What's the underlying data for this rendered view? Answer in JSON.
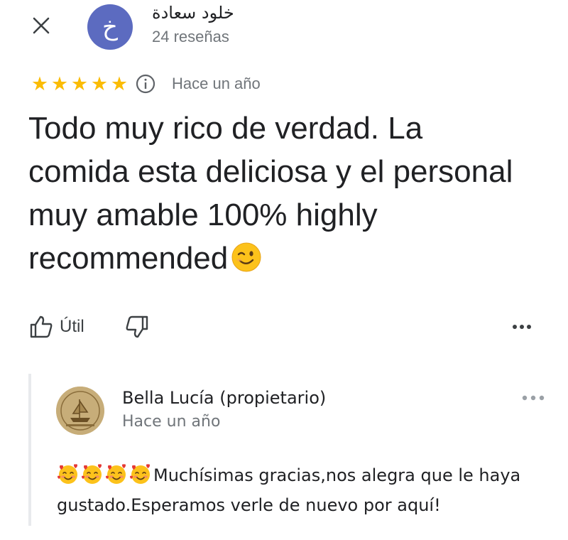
{
  "review": {
    "author_name": "خلود سعادة",
    "author_initial": "خ",
    "author_review_count": "24 reseñas",
    "avatar_color": "#5c6bc0",
    "rating": 5,
    "date": "Hace un año",
    "text": "Todo muy rico de verdad. La comida esta deliciosa y el personal muy amable 100% highly recommended",
    "text_emoji": "winking-face"
  },
  "icons": {
    "close": "close-icon",
    "info": "info-icon",
    "thumbs_up": "thumbs-up-icon",
    "thumbs_down": "thumbs-down-icon",
    "more": "more-horizontal-icon",
    "star_color": "#fbbc04"
  },
  "actions": {
    "useful_label": "Útil"
  },
  "reply": {
    "owner_name": "Bella Lucía (propietario)",
    "date": "Hace un año",
    "emoji": "smiling-face-with-hearts",
    "emoji_count": 4,
    "text": "Muchísimas gracias,nos alegra que le haya gustado.Esperamos verle de nuevo por aquí!"
  }
}
